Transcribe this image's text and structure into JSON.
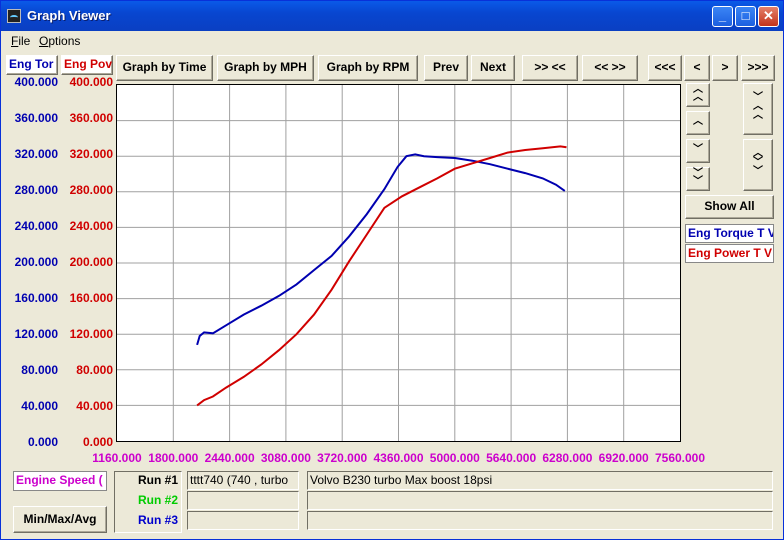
{
  "window": {
    "title": "Graph Viewer"
  },
  "menu": [
    "File",
    "Options"
  ],
  "toolbar": {
    "by_time": "Graph by Time",
    "by_mph": "Graph by MPH",
    "by_rpm": "Graph by RPM",
    "prev": "Prev",
    "next": "Next",
    "zoom_in": ">> <<",
    "zoom_out": "<< >>",
    "far_left": "<<<",
    "left": "<",
    "right": ">",
    "far_right": ">>>"
  },
  "left_headers": {
    "torque": "Eng Tor",
    "power": "Eng Pov"
  },
  "side": {
    "show_all": "Show All",
    "legend_torque": "Eng Torque T V",
    "legend_power": "Eng Power T V"
  },
  "bottom": {
    "x_channel": "Engine Speed (",
    "minmax": "Min/Max/Avg",
    "runs": [
      {
        "label": "Run #1",
        "file": "tttt740 (740  , turbo",
        "desc": "Volvo B230 turbo   Max boost 18psi",
        "color": "#000000"
      },
      {
        "label": "Run #2",
        "file": "",
        "desc": "",
        "color": "#00cc00"
      },
      {
        "label": "Run #3",
        "file": "",
        "desc": "",
        "color": "#0000cc"
      }
    ]
  },
  "colors": {
    "torque": "#0000b0",
    "power": "#d00000",
    "xaxis": "#cc00cc"
  },
  "chart_data": {
    "type": "line",
    "x_ticks": [
      "1160.000",
      "1800.000",
      "2440.000",
      "3080.000",
      "3720.000",
      "4360.000",
      "5000.000",
      "5640.000",
      "6280.000",
      "6920.000",
      "7560.000"
    ],
    "y_ticks_left": [
      "400.000",
      "360.000",
      "320.000",
      "280.000",
      "240.000",
      "200.000",
      "160.000",
      "120.000",
      "80.000",
      "40.000",
      "0.000"
    ],
    "y_ticks_right": [
      "400.000",
      "360.000",
      "320.000",
      "280.000",
      "240.000",
      "200.000",
      "160.000",
      "120.000",
      "80.000",
      "40.000",
      "0.000"
    ],
    "xlim": [
      1160,
      7560
    ],
    "ylim": [
      0,
      400
    ],
    "grid": true,
    "series": [
      {
        "name": "Eng Torque T V",
        "color": "#0000b0",
        "x": [
          2070,
          2100,
          2150,
          2250,
          2400,
          2600,
          2800,
          3000,
          3200,
          3400,
          3600,
          3800,
          4000,
          4200,
          4350,
          4450,
          4550,
          4650,
          4800,
          5000,
          5200,
          5400,
          5600,
          5800,
          6000,
          6150,
          6250
        ],
        "y": [
          108,
          118,
          122,
          121,
          130,
          142,
          152,
          163,
          176,
          192,
          208,
          230,
          255,
          283,
          308,
          320,
          322,
          320,
          319,
          318,
          315,
          311,
          306,
          301,
          295,
          288,
          281
        ]
      },
      {
        "name": "Eng Power T V",
        "color": "#d00000",
        "x": [
          2070,
          2150,
          2250,
          2400,
          2600,
          2800,
          3000,
          3200,
          3400,
          3600,
          3800,
          4000,
          4200,
          4400,
          4600,
          4800,
          5000,
          5200,
          5400,
          5600,
          5800,
          6000,
          6200,
          6270
        ],
        "y": [
          40,
          46,
          50,
          60,
          72,
          86,
          102,
          120,
          142,
          170,
          202,
          232,
          262,
          275,
          285,
          295,
          306,
          312,
          318,
          324,
          327,
          329,
          331,
          330
        ]
      }
    ]
  }
}
